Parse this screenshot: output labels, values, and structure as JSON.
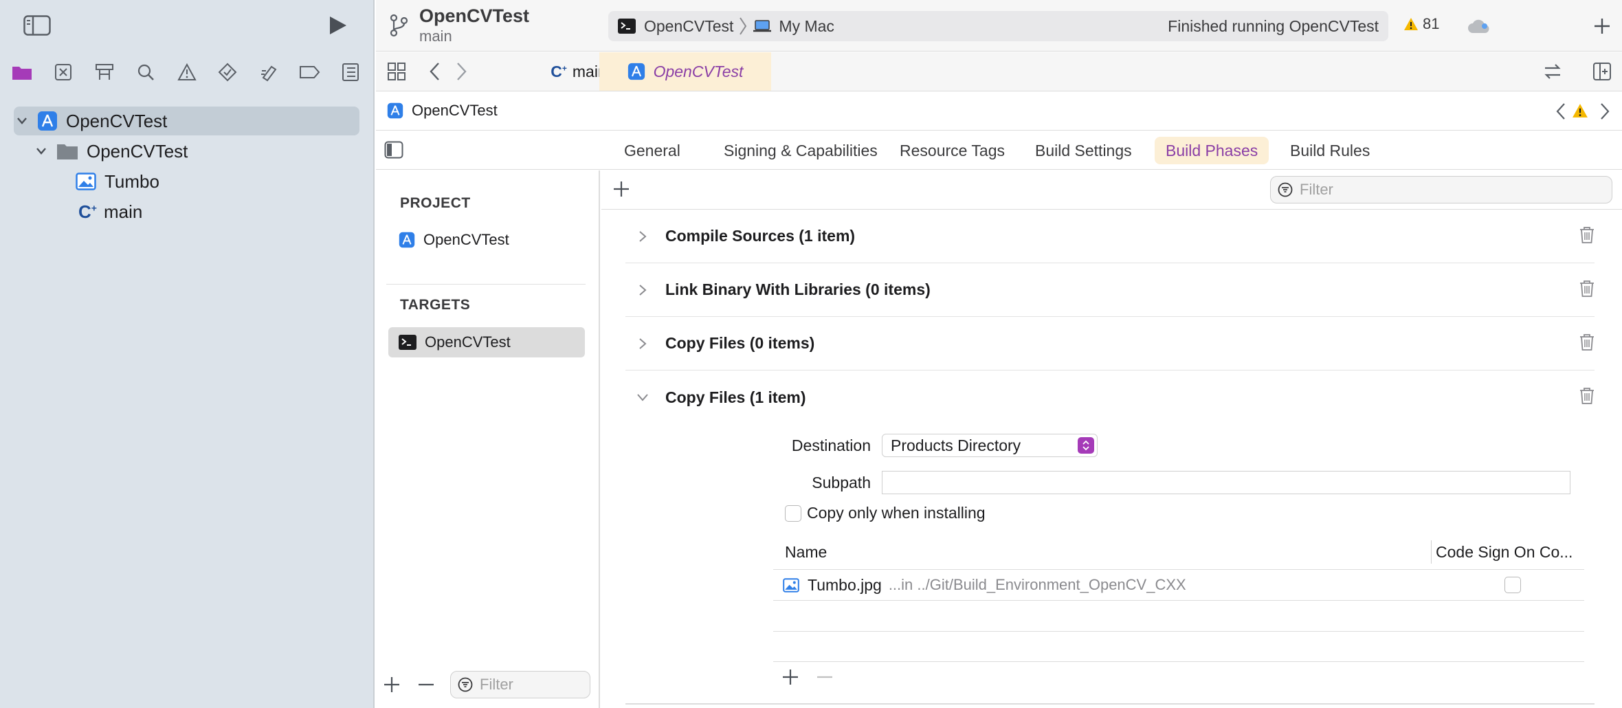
{
  "sidebar": {
    "tree": [
      {
        "label": "OpenCVTest",
        "type": "project"
      },
      {
        "label": "OpenCVTest",
        "type": "folder"
      },
      {
        "label": "Tumbo",
        "type": "image"
      },
      {
        "label": "main",
        "type": "cplusplus"
      }
    ]
  },
  "toolbar": {
    "project_name": "OpenCVTest",
    "branch": "main",
    "scheme": "OpenCVTest",
    "destination": "My Mac",
    "status": "Finished running OpenCVTest",
    "warning_count": "81"
  },
  "tabs": [
    {
      "label": "main",
      "icon": "C⁺"
    },
    {
      "label": "OpenCVTest",
      "active": true
    }
  ],
  "jumpbar": {
    "label": "OpenCVTest"
  },
  "settings_tabs": [
    {
      "label": "General"
    },
    {
      "label": "Signing & Capabilities"
    },
    {
      "label": "Resource Tags"
    },
    {
      "label": "Build Settings"
    },
    {
      "label": "Build Phases",
      "active": true
    },
    {
      "label": "Build Rules"
    }
  ],
  "targets_panel": {
    "project_header": "PROJECT",
    "project_item": "OpenCVTest",
    "targets_header": "TARGETS",
    "target_item": "OpenCVTest",
    "filter_placeholder": "Filter"
  },
  "phases": {
    "filter_placeholder": "Filter",
    "items": [
      {
        "title": "Compile Sources (1 item)",
        "expanded": false
      },
      {
        "title": "Link Binary With Libraries (0 items)",
        "expanded": false
      },
      {
        "title": "Copy Files (0 items)",
        "expanded": false
      },
      {
        "title": "Copy Files (1 item)",
        "expanded": true
      }
    ],
    "copy_files": {
      "destination_label": "Destination",
      "destination_value": "Products Directory",
      "subpath_label": "Subpath",
      "subpath_value": "",
      "copy_only_label": "Copy only when installing",
      "col_name": "Name",
      "col_codesign": "Code Sign On Co...",
      "rows": [
        {
          "name": "Tumbo.jpg",
          "location": "...in ../Git/Build_Environment_OpenCV_CXX"
        }
      ]
    }
  },
  "colors": {
    "accent": "#8a3ea6",
    "sidebar_bg": "#dce3ea",
    "warning": "#f5b800",
    "icon_blue": "#2f7fe8"
  }
}
